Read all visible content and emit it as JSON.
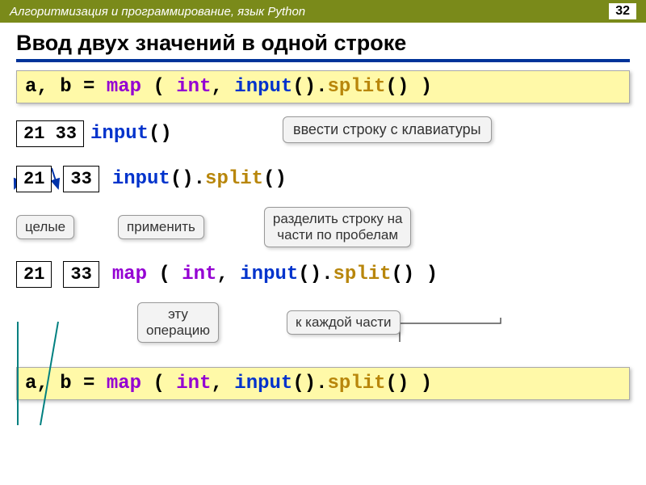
{
  "header": {
    "course": "Алгоритмизация и программирование, язык Python",
    "page": "32"
  },
  "title": "Ввод двух значений в одной строке",
  "code": {
    "ab": "a, b",
    "eq": " = ",
    "map": "map",
    "sp": " ",
    "lp": "( ",
    "lp2": "(",
    "int": "int",
    "comma": ", ",
    "input": "input",
    "call": "()",
    "dot": ".",
    "split": "split",
    "rp": " )",
    "rp2": ")"
  },
  "vals": {
    "joined": "21 33",
    "a": "21",
    "b": "33"
  },
  "bubbles": {
    "enter": "ввести строку с клавиатуры",
    "ints": "целые",
    "apply": "применить",
    "splitparts": "разделить строку на\nчасти по пробелам",
    "thisop": "эту\nоперацию",
    "each": "к каждой части"
  }
}
